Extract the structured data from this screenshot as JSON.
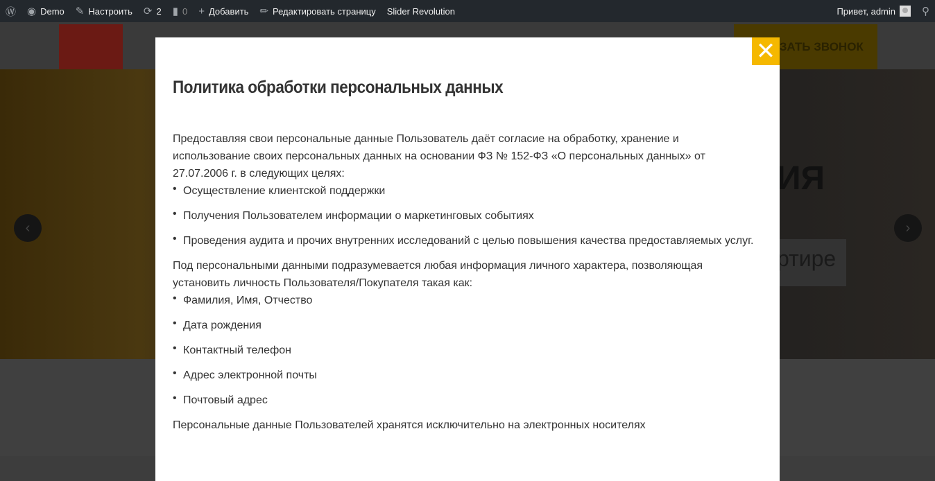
{
  "adminbar": {
    "demo": "Demo",
    "customize": "Настроить",
    "updates": "2",
    "comments": "0",
    "add": "Добавить",
    "edit": "Редактировать страницу",
    "slider": "Slider Revolution",
    "greeting": "Привет, admin"
  },
  "page": {
    "call_button": "ЗАКАЗАТЬ ЗВОНОК",
    "slide_heading": "ИЯ",
    "slide_sub": "ртире"
  },
  "modal": {
    "title": "Политика обработки персональных данных",
    "intro": "Предоставляя свои персональные данные Пользователь даёт согласие на обработку, хранение и использование своих персональных данных на основании ФЗ № 152-ФЗ «О персональных данных» от 27.07.2006 г. в следующих целях:",
    "purposes": [
      "Осуществление клиентской поддержки",
      "Получения Пользователем информации о маркетинговых событиях",
      "Проведения аудита и прочих внутренних исследований с целью повышения качества предоставляемых услуг."
    ],
    "definition": "Под персональными данными подразумевается любая информация личного характера, позволяющая установить личность Пользователя/Покупателя такая как:",
    "data_items": [
      "Фамилия, Имя, Отчество",
      "Дата рождения",
      "Контактный телефон",
      "Адрес электронной почты",
      "Почтовый адрес"
    ],
    "storage": "Персональные данные Пользователей хранятся исключительно на электронных носителях"
  }
}
